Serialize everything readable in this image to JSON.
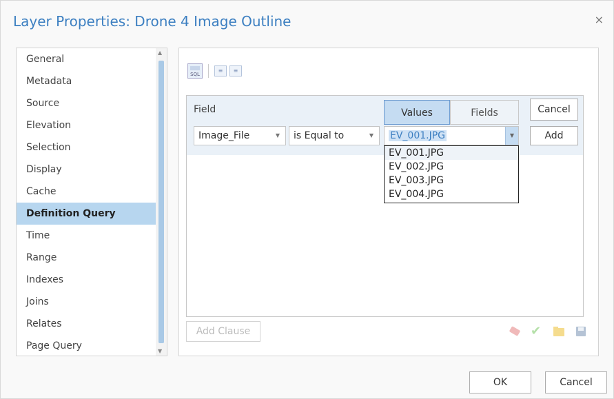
{
  "dialog": {
    "title": "Layer Properties: Drone 4 Image Outline",
    "close_glyph": "×"
  },
  "sidebar": {
    "items": [
      {
        "label": "General"
      },
      {
        "label": "Metadata"
      },
      {
        "label": "Source"
      },
      {
        "label": "Elevation"
      },
      {
        "label": "Selection"
      },
      {
        "label": "Display"
      },
      {
        "label": "Cache"
      },
      {
        "label": "Definition Query",
        "selected": true
      },
      {
        "label": "Time"
      },
      {
        "label": "Range"
      },
      {
        "label": "Indexes"
      },
      {
        "label": "Joins"
      },
      {
        "label": "Relates"
      },
      {
        "label": "Page Query"
      }
    ]
  },
  "toolbar": {
    "sql_label": "SQL",
    "icons": [
      "sql-toggle-icon",
      "indent-decrease-icon",
      "indent-increase-icon"
    ]
  },
  "clause": {
    "field_label": "Field",
    "values_tab": "Values",
    "fields_tab": "Fields",
    "field_select": "Image_File",
    "operator_select": "is Equal to",
    "value_select": "EV_001.JPG",
    "cancel_label": "Cancel",
    "add_label": "Add",
    "dropdown_options": [
      "EV_001.JPG",
      "EV_002.JPG",
      "EV_003.JPG",
      "EV_004.JPG"
    ]
  },
  "actions": {
    "add_clause_label": "Add Clause",
    "icons": [
      "eraser-icon",
      "check-icon",
      "folder-icon",
      "save-icon"
    ]
  },
  "footer": {
    "ok_label": "OK",
    "cancel_label": "Cancel"
  },
  "colors": {
    "title": "#3c7fc1",
    "selected_item": "#b7d6ef",
    "clause_bg": "#eaf1f8"
  }
}
